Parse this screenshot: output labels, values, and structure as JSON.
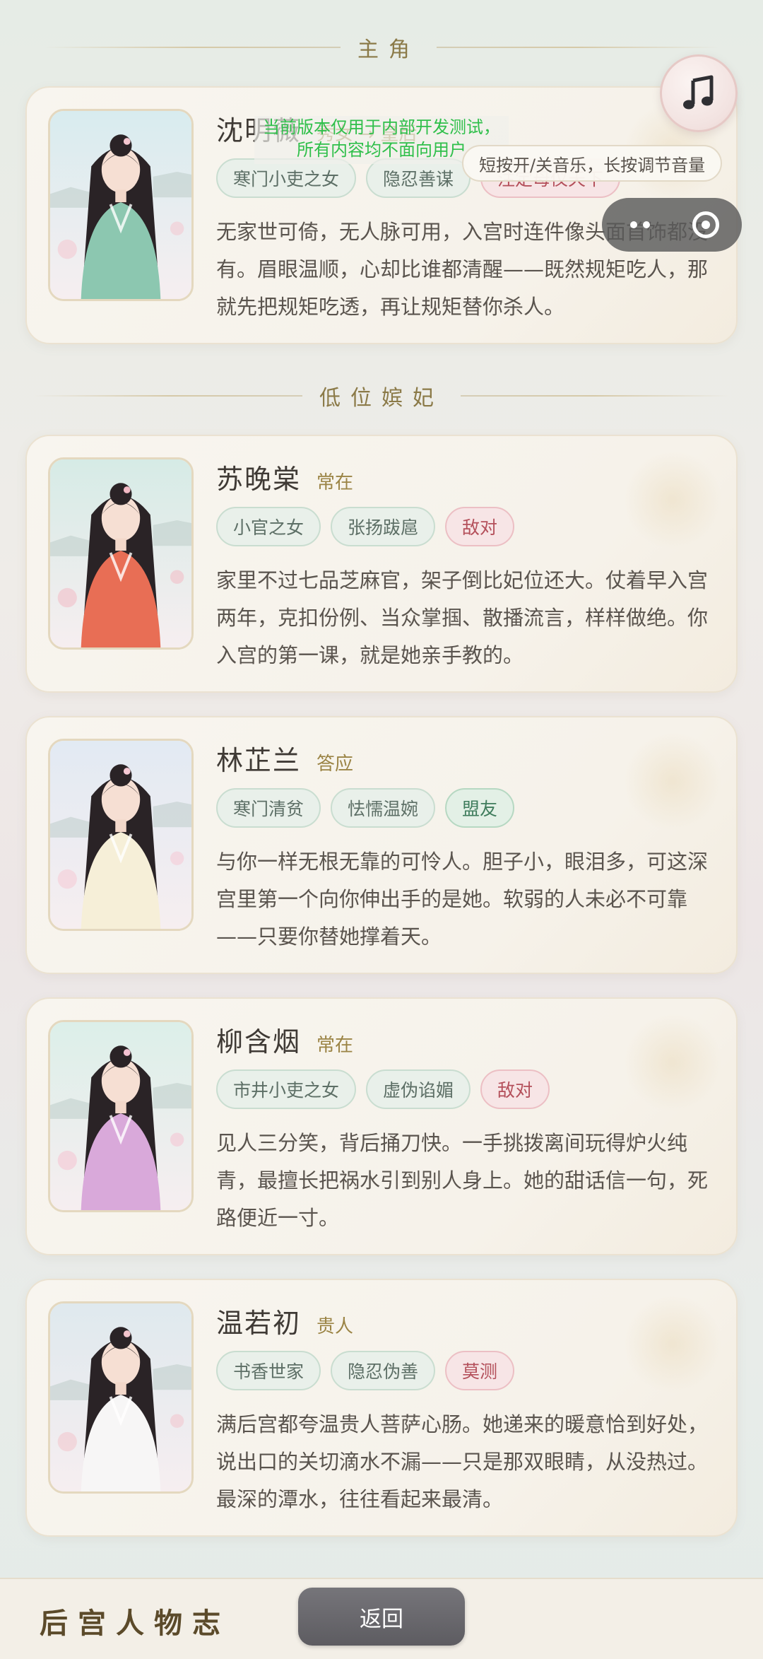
{
  "sections": {
    "protagonist": "主角",
    "low_rank": "低位嫔妃"
  },
  "characters": [
    {
      "name": "沈明薇",
      "rank": "秀女 → 皇后",
      "tags": [
        {
          "label": "寒门小吏之女",
          "type": "neutral"
        },
        {
          "label": "隐忍善谋",
          "type": "neutral"
        },
        {
          "label": "注定母仪天下",
          "type": "hostile"
        }
      ],
      "description": "无家世可倚，无人脉可用，入宫时连件像头面首饰都没有。眉眼温顺，心却比谁都清醒——既然规矩吃人，那就先把规矩吃透，再让规矩替你杀人。",
      "colors": {
        "sky": "#d8ecef",
        "robe": "#8cc7b0",
        "accent": "#f4c6cf"
      }
    },
    {
      "name": "苏晚棠",
      "rank": "常在",
      "tags": [
        {
          "label": "小官之女",
          "type": "neutral"
        },
        {
          "label": "张扬跋扈",
          "type": "neutral"
        },
        {
          "label": "敌对",
          "type": "hostile"
        }
      ],
      "description": "家里不过七品芝麻官，架子倒比妃位还大。仗着早入宫两年，克扣份例、当众掌掴、散播流言，样样做绝。你入宫的第一课，就是她亲手教的。",
      "colors": {
        "sky": "#d6ebe6",
        "robe": "#e86e55",
        "accent": "#f2b9c4"
      }
    },
    {
      "name": "林芷兰",
      "rank": "答应",
      "tags": [
        {
          "label": "寒门清贫",
          "type": "neutral"
        },
        {
          "label": "怯懦温婉",
          "type": "neutral"
        },
        {
          "label": "盟友",
          "type": "ally"
        }
      ],
      "description": "与你一样无根无靠的可怜人。胆子小，眼泪多，可这深宫里第一个向你伸出手的是她。软弱的人未必不可靠——只要你替她撑着天。",
      "colors": {
        "sky": "#e2eaf3",
        "robe": "#f6efd8",
        "accent": "#f6c9d4"
      }
    },
    {
      "name": "柳含烟",
      "rank": "常在",
      "tags": [
        {
          "label": "市井小吏之女",
          "type": "neutral"
        },
        {
          "label": "虚伪谄媚",
          "type": "neutral"
        },
        {
          "label": "敌对",
          "type": "hostile"
        }
      ],
      "description": "见人三分笑，背后捅刀快。一手挑拨离间玩得炉火纯青，最擅长把祸水引到别人身上。她的甜话信一句，死路便近一寸。",
      "colors": {
        "sky": "#dcefe9",
        "robe": "#d9a9da",
        "accent": "#f5c2d2"
      }
    },
    {
      "name": "温若初",
      "rank": "贵人",
      "tags": [
        {
          "label": "书香世家",
          "type": "neutral"
        },
        {
          "label": "隐忍伪善",
          "type": "neutral"
        },
        {
          "label": "莫测",
          "type": "hostile"
        }
      ],
      "description": "满后宫都夸温贵人菩萨心肠。她递来的暖意恰到好处，说出口的关切滴水不漏——只是那双眼睛，从没热过。最深的潭水，往往看起来最清。",
      "colors": {
        "sky": "#dfe9ee",
        "robe": "#f7f6f6",
        "accent": "#f3c4cc"
      }
    }
  ],
  "overlays": {
    "test_notice_line1": "当前版本仅用于内部开发测试，",
    "test_notice_line2": "所有内容均不面向用户",
    "music_tip": "短按开/关音乐，长按调节音量"
  },
  "footer": {
    "title": "后宫人物志",
    "back_label": "返回"
  }
}
